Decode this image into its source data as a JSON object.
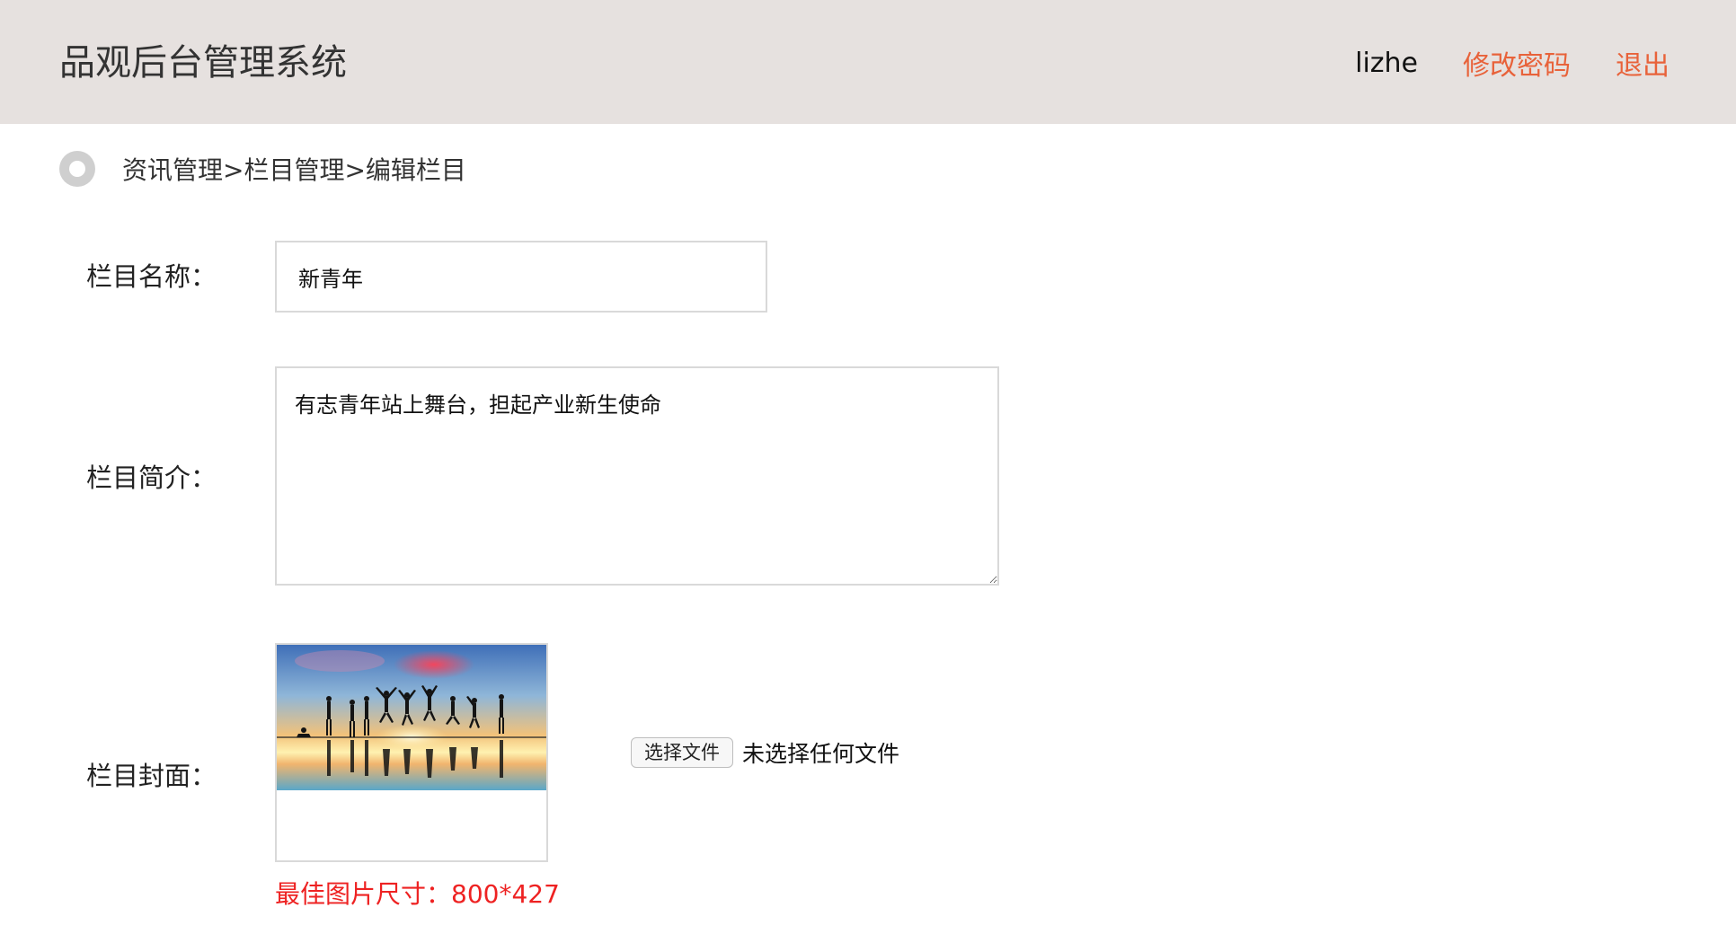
{
  "header": {
    "title": "品观后台管理系统",
    "username": "lizhe",
    "change_password": "修改密码",
    "logout": "退出",
    "background": "#e6e1df",
    "accent": "#e8623a"
  },
  "breadcrumb": {
    "icon": "circle-bullet-icon",
    "text": "资讯管理>栏目管理>编辑栏目"
  },
  "form": {
    "name_label": "栏目名称：",
    "name_value": "新青年",
    "intro_label": "栏目简介：",
    "intro_value": "有志青年站上舞台，担起产业新生使命",
    "cover_label": "栏目封面：",
    "cover_image": "jumping-silhouettes-sunset-photo",
    "file_button": "选择文件",
    "file_status": "未选择任何文件",
    "size_hint": "最佳图片尺寸：800*427",
    "hint_color": "#ee2222"
  }
}
